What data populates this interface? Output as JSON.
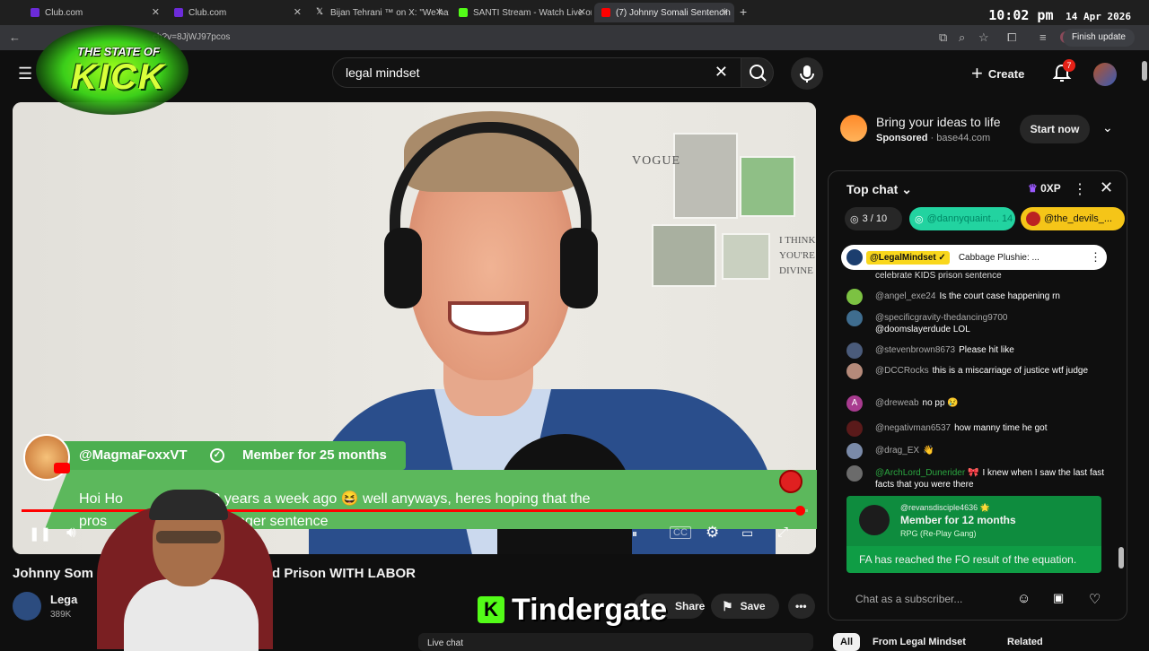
{
  "browser": {
    "tabs": [
      {
        "label": "Club.com",
        "icon_color": "#6c2bd9"
      },
      {
        "label": "Club.com",
        "icon_color": "#6c2bd9"
      },
      {
        "label": "Bijan Tehrani ™ on X: \"We have",
        "icon_color": "#ffffff"
      },
      {
        "label": "SANTI Stream - Watch Live on K",
        "icon_color": "#53fc18"
      },
      {
        "label": "(7) Johnny Somali Sentencin",
        "icon_color": "#ff0000"
      }
    ],
    "time": "10:02 pm",
    "date": "14 Apr 2026",
    "url": "ch?v=8JjWJ97pcos",
    "finish_update": "Finish update"
  },
  "overlay": {
    "logo_top": "THE STATE OF",
    "logo_main": "KICK",
    "tindergate": "Tindergate"
  },
  "youtube": {
    "search_value": "legal mindset",
    "create_label": "Create",
    "notif_count": "7"
  },
  "video": {
    "wall_text_1": "VOGUE",
    "wall_text_2": "I THINK\nYOU'RE\nDIVINE",
    "alert": {
      "username": "@MagmaFoxxVT",
      "member_text": "Member for 25 months",
      "message": "Hoi Ho... Just hit 2 years a week ago 😆 well anyways, heres hoping that the prosecution appeals for a longer sentence",
      "message_line1": "Hoi Ho          Just hit 2 years a week ago 😆 well anyways, heres hoping that the",
      "message_line2": "pros              eals for a longer sentence"
    },
    "progress": 0.99
  },
  "below_video": {
    "title_left": "Johnny Som",
    "title_right": "ty and Prison WITH LABOR",
    "channel_name": "Lega",
    "channel_subs": "389K",
    "share_label": "Share",
    "save_label": "Save",
    "live_chat_label": "Live chat"
  },
  "ad": {
    "headline": "Bring your ideas to life",
    "sponsored": "Sponsored",
    "domain": "base44.com",
    "cta": "Start now"
  },
  "chat": {
    "header": "Top chat",
    "xp": "0XP",
    "chips": [
      {
        "label": "3 / 10"
      },
      {
        "label": "@dannyquaint...  14"
      },
      {
        "label": "@the_devils_..."
      }
    ],
    "pinned": {
      "author": "@LegalMindset ✓",
      "text": "Cabbage Plushie: ..."
    },
    "partial_line": "celebrate KIDS prison sentence",
    "messages": [
      {
        "author": "@angel_exe24",
        "text": "Is the court case happening rn",
        "color": "#7cc242"
      },
      {
        "author": "@specificgravity-thedancing9700",
        "text": "@doomslayerdude LOL",
        "color": "#3f6d8f"
      },
      {
        "author": "@stevenbrown8673",
        "text": "Please hit like",
        "color": "#4a5b7a"
      },
      {
        "author": "@DCCRocks",
        "text": "this is a miscarriage of justice wtf judge",
        "color": "#b58a7a"
      },
      {
        "author": "@dreweab",
        "text": "no pp 😢",
        "color": "#a83b8f"
      },
      {
        "author": "@negativman6537",
        "text": "how manny time he got",
        "color": "#5a1a1a"
      },
      {
        "author": "@drag_EX",
        "text": "👋",
        "color": "#7a8aa8"
      },
      {
        "author": "@ArchLord_Dunerider 🎀",
        "text": "I knew when I saw the last fast facts that you were there",
        "color": "#6b6b6b"
      }
    ],
    "member": {
      "username": "@revansdisciple4636 🌟",
      "months": "Member for 12 months",
      "group": "RPG (Re-Play Gang)",
      "message": "FA has reached the FO result of the equation."
    },
    "input_placeholder": "Chat as a subscriber...",
    "tabs": [
      "All",
      "From Legal Mindset",
      "Related"
    ]
  }
}
